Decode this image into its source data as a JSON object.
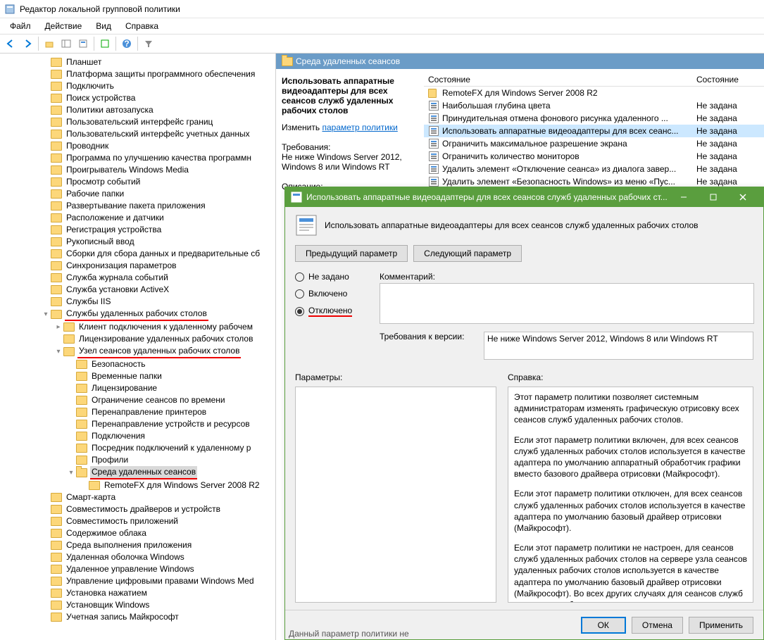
{
  "window": {
    "title": "Редактор локальной групповой политики"
  },
  "menu": {
    "file": "Файл",
    "action": "Действие",
    "view": "Вид",
    "help": "Справка"
  },
  "tree": {
    "items": [
      "Планшет",
      "Платформа защиты программного обеспечения",
      "Подключить",
      "Поиск устройства",
      "Политики автозапуска",
      "Пользовательский интерфейс границ",
      "Пользовательский интерфейс учетных данных",
      "Проводник",
      "Программа по улучшению качества программн",
      "Проигрыватель Windows Media",
      "Просмотр событий",
      "Рабочие папки",
      "Развертывание пакета приложения",
      "Расположение и датчики",
      "Регистрация устройства",
      "Рукописный ввод",
      "Сборки для сбора данных и предварительные сб",
      "Синхронизация параметров",
      "Служба журнала событий",
      "Служба установки ActiveX",
      "Службы IIS"
    ],
    "rds": "Службы удаленных рабочих столов",
    "rds_children": [
      "Клиент подключения к удаленному рабочем",
      "Лицензирование удаленных рабочих столов"
    ],
    "session_host": "Узел сеансов удаленных рабочих столов",
    "session_children": [
      "Безопасность",
      "Временные папки",
      "Лицензирование",
      "Ограничение сеансов по времени",
      "Перенаправление принтеров",
      "Перенаправление устройств и ресурсов",
      "Подключения",
      "Посредник подключений к удаленному р",
      "Профили"
    ],
    "remote_env": "Среда удаленных сеансов",
    "remote_child": "RemoteFX для Windows Server 2008 R2",
    "after": [
      "Смарт-карта",
      "Совместимость драйверов и устройств",
      "Совместимость приложений",
      "Содержимое облака",
      "Среда выполнения приложения",
      "Удаленная оболочка Windows",
      "Удаленное управление Windows",
      "Управление цифровыми правами Windows Med",
      "Установка нажатием",
      "Установщик Windows",
      "Учетная запись Майкрософт"
    ]
  },
  "content": {
    "header": "Среда удаленных сеансов",
    "desc_title": "Использовать аппаратные видеоадаптеры для всех сеансов служб удаленных рабочих столов",
    "edit": "Изменить",
    "edit_link": "параметр политики",
    "req_label": "Требования:",
    "req_text": "Не ниже Windows Server 2012, Windows 8 или Windows RT",
    "desc_label": "Описание:",
    "list_h1": "Состояние",
    "list_h2": "Состояние",
    "rows": [
      {
        "icon": "folder",
        "name": "RemoteFX для Windows Server 2008 R2",
        "state": ""
      },
      {
        "icon": "set",
        "name": "Наибольшая глубина цвета",
        "state": "Не задана"
      },
      {
        "icon": "set",
        "name": "Принудительная отмена фонового рисунка удаленного ...",
        "state": "Не задана"
      },
      {
        "icon": "set",
        "name": "Использовать аппаратные видеоадаптеры для всех сеанс...",
        "state": "Не задана",
        "sel": true
      },
      {
        "icon": "set",
        "name": "Ограничить максимальное разрешение экрана",
        "state": "Не задана"
      },
      {
        "icon": "set",
        "name": "Ограничить количество мониторов",
        "state": "Не задана"
      },
      {
        "icon": "set",
        "name": "Удалить элемент «Отключение сеанса» из диалога завер...",
        "state": "Не задана"
      },
      {
        "icon": "set",
        "name": "Удалить элемент «Безопасность Windows» из меню «Пус...",
        "state": "Не задана"
      }
    ]
  },
  "dialog": {
    "title": "Использовать аппаратные видеоадаптеры для всех сеансов служб удаленных рабочих ст...",
    "heading": "Использовать аппаратные видеоадаптеры для всех сеансов служб удаленных рабочих столов",
    "prev": "Предыдущий параметр",
    "next": "Следующий параметр",
    "radio_nc": "Не задано",
    "radio_on": "Включено",
    "radio_off": "Отключено",
    "comment_label": "Комментарий:",
    "ver_label": "Требования к версии:",
    "ver_text": "Не ниже Windows Server 2012, Windows 8 или Windows RT",
    "params_label": "Параметры:",
    "help_label": "Справка:",
    "help_p1": "Этот параметр политики позволяет системным администраторам изменять графическую отрисовку всех сеансов служб удаленных рабочих столов.",
    "help_p2": "Если этот параметр политики включен, для всех сеансов служб удаленных рабочих столов используется в качестве адаптера по умолчанию аппаратный обработчик графики вместо базового драйвера отрисовки (Майкрософт).",
    "help_p3": "Если этот параметр политики отключен, для всех сеансов служб удаленных рабочих столов используется в качестве адаптера по умолчанию базовый драйвер отрисовки (Майкрософт).",
    "help_p4": "Если этот параметр политики не настроен, для сеансов служб удаленных рабочих столов на сервере узла сеансов удаленных рабочих столов используется в качестве адаптера по умолчанию базовый драйвер отрисовки (Майкрософт). Во всех других случаях для сеансов служб удаленных рабочих",
    "ok": "ОК",
    "cancel": "Отмена",
    "apply": "Применить",
    "footer_note": "Данный параметр политики не"
  }
}
